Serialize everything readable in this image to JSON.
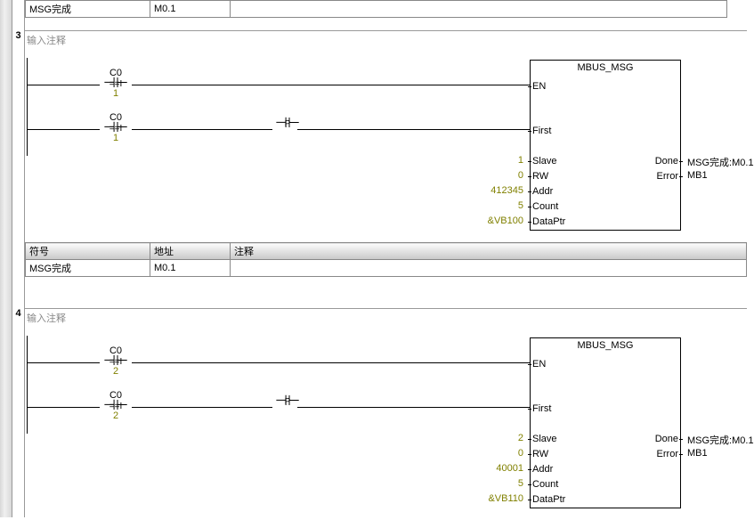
{
  "labels": {
    "comment": "输入注释",
    "sym_hdr_symbol": "符号",
    "sym_hdr_addr": "地址",
    "sym_hdr_comment": "注释"
  },
  "top_partial": {
    "row": {
      "symbol": "MSG完成",
      "addr": "M0.1",
      "comment": ""
    }
  },
  "networks": [
    {
      "num": "3",
      "contacts": [
        {
          "top": "C0",
          "op": "==I",
          "val": "1"
        },
        {
          "top": "C0",
          "op": "==I",
          "val": "1"
        }
      ],
      "edge": "P",
      "block": {
        "title": "MBUS_MSG",
        "pins_left": [
          {
            "name": "EN",
            "val": ""
          },
          {
            "name": "First",
            "val": ""
          },
          {
            "name": "Slave",
            "val": "1"
          },
          {
            "name": "RW",
            "val": "0"
          },
          {
            "name": "Addr",
            "val": "412345"
          },
          {
            "name": "Count",
            "val": "5"
          },
          {
            "name": "DataPtr",
            "val": "&VB100"
          }
        ],
        "pins_right": [
          {
            "name": "Done",
            "val": "MSG完成:M0.1"
          },
          {
            "name": "Error",
            "val": "MB1"
          }
        ]
      },
      "sym_table": [
        {
          "symbol": "MSG完成",
          "addr": "M0.1",
          "comment": ""
        }
      ]
    },
    {
      "num": "4",
      "contacts": [
        {
          "top": "C0",
          "op": "==I",
          "val": "2"
        },
        {
          "top": "C0",
          "op": "==I",
          "val": "2"
        }
      ],
      "edge": "P",
      "block": {
        "title": "MBUS_MSG",
        "pins_left": [
          {
            "name": "EN",
            "val": ""
          },
          {
            "name": "First",
            "val": ""
          },
          {
            "name": "Slave",
            "val": "2"
          },
          {
            "name": "RW",
            "val": "0"
          },
          {
            "name": "Addr",
            "val": "40001"
          },
          {
            "name": "Count",
            "val": "5"
          },
          {
            "name": "DataPtr",
            "val": "&VB110"
          }
        ],
        "pins_right": [
          {
            "name": "Done",
            "val": "MSG完成:M0.1"
          },
          {
            "name": "Error",
            "val": "MB1"
          }
        ]
      }
    }
  ]
}
